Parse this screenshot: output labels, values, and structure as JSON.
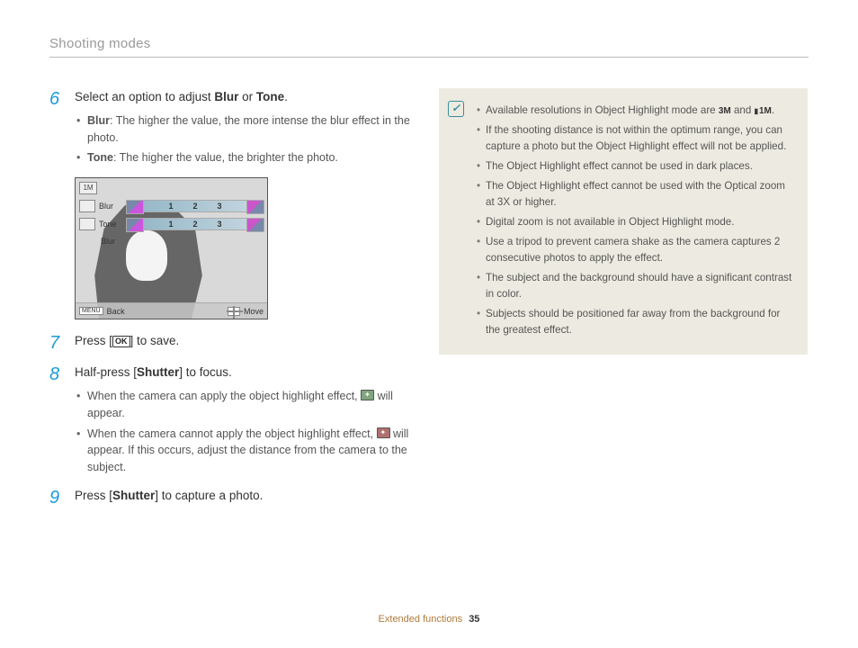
{
  "header": {
    "section_title": "Shooting modes"
  },
  "steps": {
    "s6": {
      "num": "6",
      "title_pre": "Select an option to adjust ",
      "title_b1": "Blur",
      "title_mid": " or ",
      "title_b2": "Tone",
      "title_post": ".",
      "bullets": [
        {
          "label": "Blur",
          "text": ": The higher the value, the more intense the blur effect in the photo."
        },
        {
          "label": "Tone",
          "text": ": The higher the value, the brighter the photo."
        }
      ]
    },
    "s7": {
      "num": "7",
      "text_pre": "Press [",
      "ok": "OK",
      "text_post": "] to save."
    },
    "s8": {
      "num": "8",
      "title_pre": "Half-press [",
      "title_b": "Shutter",
      "title_post": "] to focus.",
      "bullets": [
        {
          "text_pre": "When the camera can apply the object highlight effect, ",
          "icon": "good",
          "text_post": " will appear."
        },
        {
          "text_pre": "When the camera cannot apply the object highlight effect, ",
          "icon": "bad",
          "text_post": " will appear. If this occurs, adjust the distance from the camera to the subject."
        }
      ]
    },
    "s9": {
      "num": "9",
      "text_pre": "Press [",
      "text_b": "Shutter",
      "text_post": "] to capture a photo."
    }
  },
  "camscreen": {
    "mode_label": "1M",
    "row1_label": "Blur",
    "row2_label": "Tone",
    "slider_values": [
      "1",
      "2",
      "3"
    ],
    "sub_label": "Blur",
    "menu_label": "MENU",
    "back_label": "Back",
    "move_label": "Move"
  },
  "notes": {
    "items": [
      {
        "pre": "Available resolutions in Object Highlight mode are ",
        "res1": "3M",
        "mid": " and ",
        "res2": "1M",
        "post": "."
      },
      {
        "text": "If the shooting distance is not within the optimum range, you can capture a photo but the Object Highlight effect will not be applied."
      },
      {
        "text": "The Object Highlight effect cannot be used in dark places."
      },
      {
        "text": "The Object Highlight effect cannot be used with the Optical zoom at 3X or higher."
      },
      {
        "text": "Digital zoom is not available in Object Highlight mode."
      },
      {
        "text": "Use a tripod to prevent camera shake as the camera captures 2 consecutive photos to apply the effect."
      },
      {
        "text": "The subject and the background should have a significant contrast in color."
      },
      {
        "text": "Subjects should be positioned far away from the background for the greatest effect."
      }
    ]
  },
  "footer": {
    "chapter": "Extended functions",
    "page": "35"
  }
}
